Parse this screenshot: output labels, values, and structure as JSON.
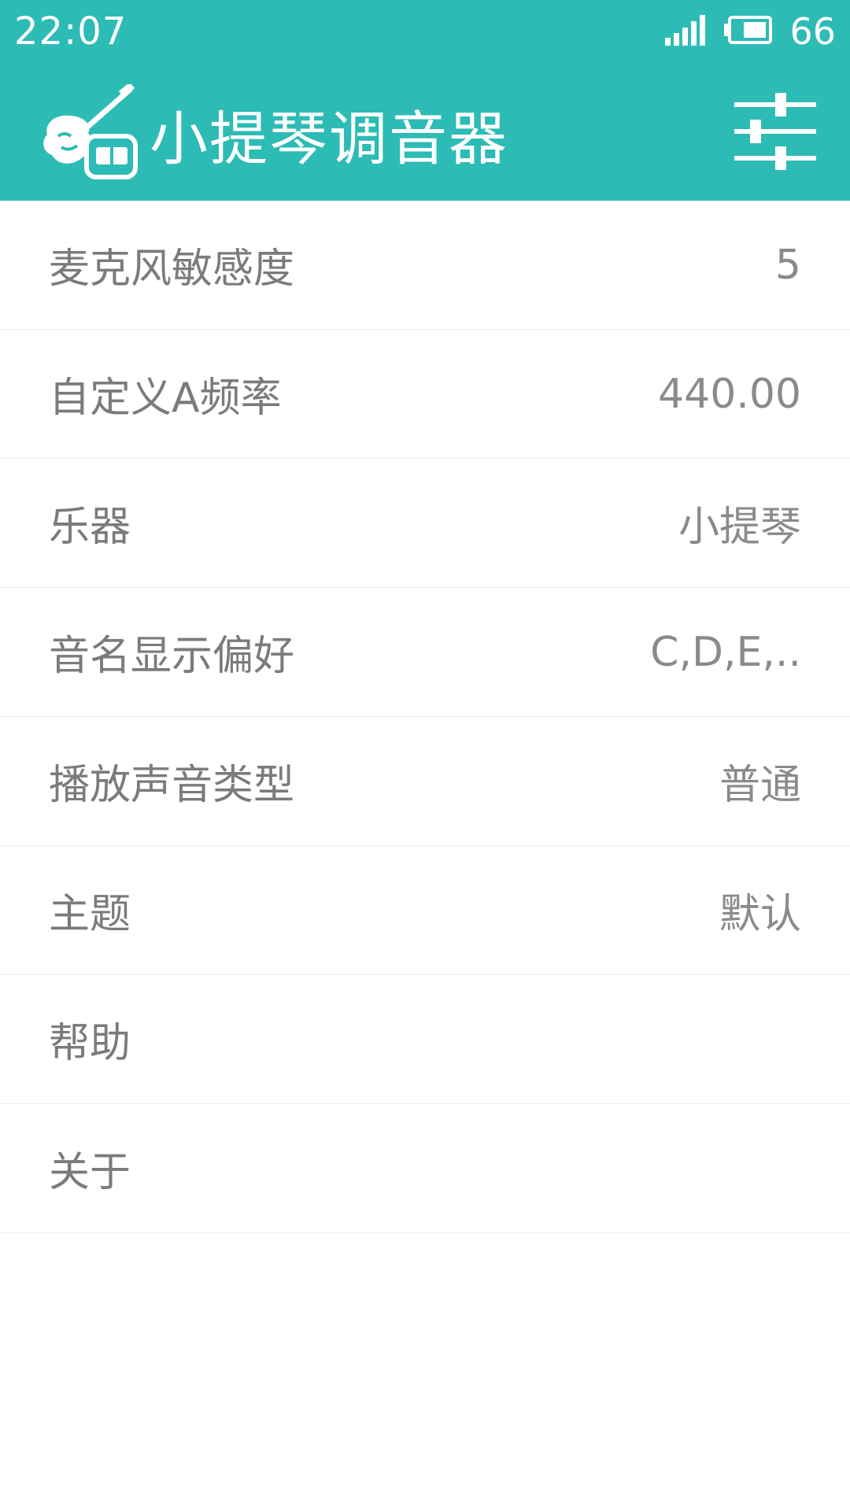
{
  "status": {
    "time": "22:07",
    "battery": "66",
    "signal_icon": "signal-icon",
    "battery_icon": "battery-icon"
  },
  "header": {
    "title": "小提琴调音器",
    "logo_icon": "violin-tuner-logo-icon",
    "settings_icon": "tune-sliders-icon",
    "background_color": "#2dbbb5"
  },
  "settings": [
    {
      "label": "麦克风敏感度",
      "value": "5"
    },
    {
      "label": "自定义A频率",
      "value": "440.00"
    },
    {
      "label": "乐器",
      "value": "小提琴"
    },
    {
      "label": "音名显示偏好",
      "value": "C,D,E,.."
    },
    {
      "label": "播放声音类型",
      "value": "普通"
    },
    {
      "label": "主题",
      "value": "默认"
    },
    {
      "label": "帮助",
      "value": ""
    },
    {
      "label": "关于",
      "value": ""
    }
  ]
}
